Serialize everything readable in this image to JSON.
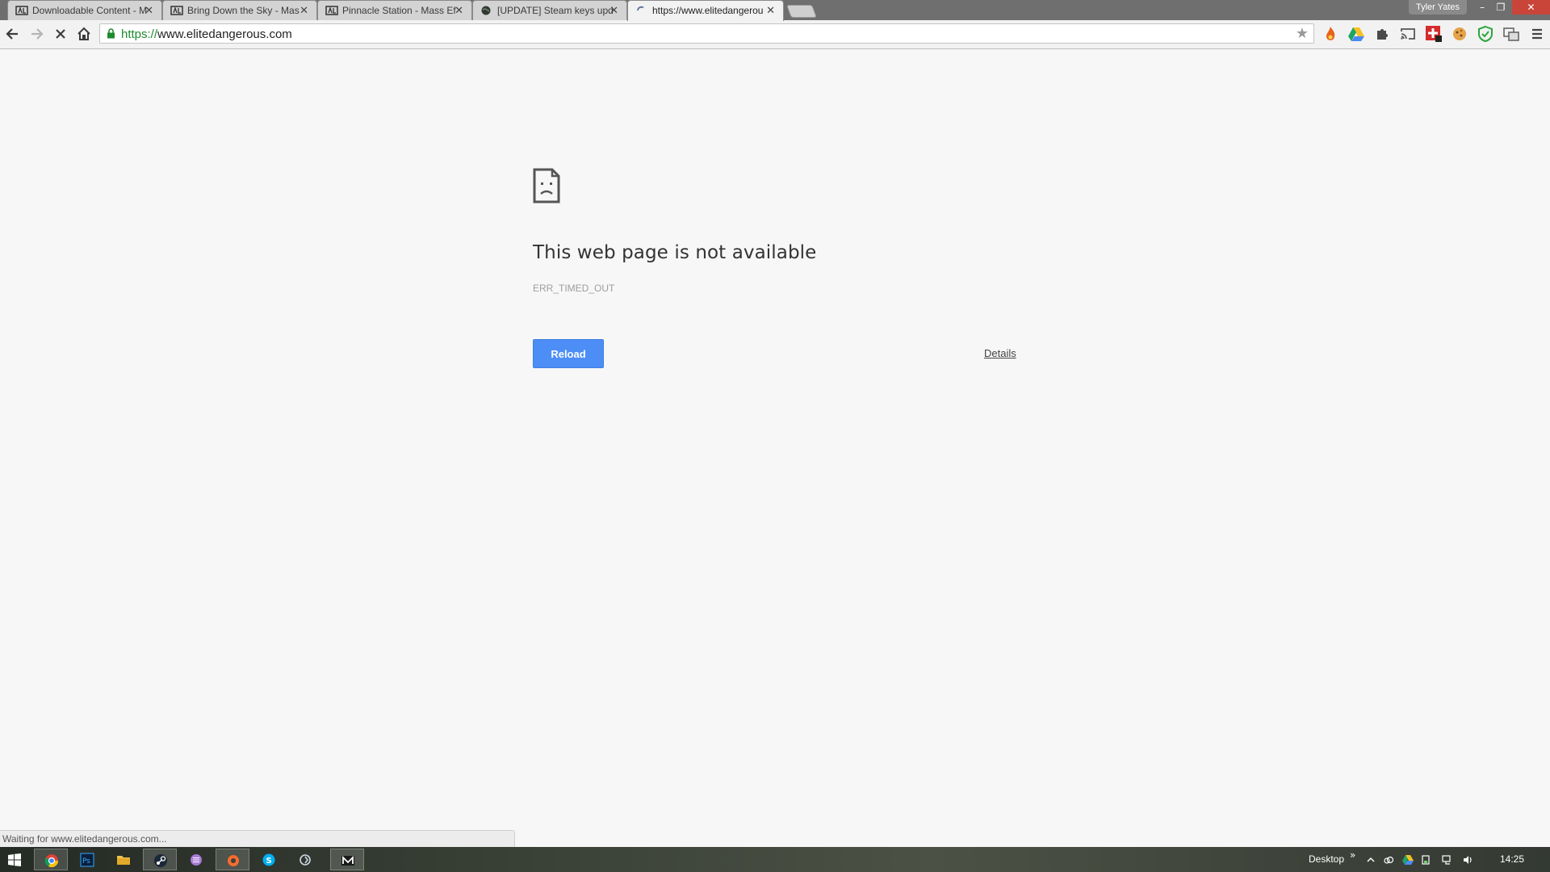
{
  "browser": {
    "tabs": [
      {
        "title": "Downloadable Content - M",
        "icon": "ea-icon",
        "active": false
      },
      {
        "title": "Bring Down the Sky - Mas",
        "icon": "ea-icon",
        "active": false
      },
      {
        "title": "Pinnacle Station - Mass Ef",
        "icon": "ea-icon",
        "active": false
      },
      {
        "title": "[UPDATE] Steam keys upd",
        "icon": "globe-icon",
        "active": false
      },
      {
        "title": "https://www.elitedangerou",
        "icon": "loading-spinner-icon",
        "active": true
      }
    ],
    "profile_name": "Tyler Yates",
    "window_controls": {
      "minimize": "–",
      "restore": "❐",
      "close": "✕"
    },
    "omnibox": {
      "scheme": "https://",
      "host": "www.elitedangerous.com"
    },
    "extensions": [
      "flame-extension-icon",
      "google-drive-icon",
      "puzzle-extension-icon",
      "cast-icon",
      "red-badge-extension-icon",
      "cookie-icon",
      "shield-check-icon",
      "translate-icon",
      "menu-icon"
    ]
  },
  "error_page": {
    "title": "This web page is not available",
    "code": "ERR_TIMED_OUT",
    "reload_label": "Reload",
    "details_label": "Details",
    "accent_color": "#4d8ef6"
  },
  "status_bar": {
    "text": "Waiting for www.elitedangerous.com..."
  },
  "taskbar": {
    "apps": [
      "chrome-icon",
      "photoshop-icon",
      "file-explorer-icon",
      "steam-icon",
      "app-purple-icon",
      "origin-icon",
      "skype-icon",
      "app-arrow-icon",
      "app-m-icon"
    ],
    "desktop_label": "Desktop",
    "clock": "14:25"
  }
}
